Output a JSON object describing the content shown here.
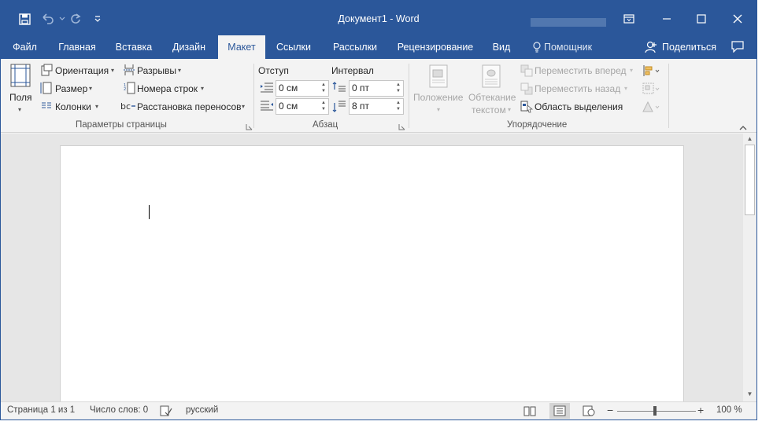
{
  "window": {
    "title": "Документ1  -  Word",
    "accent_color": "#2b579a"
  },
  "qat": {
    "save_icon": "save-icon",
    "undo_icon": "undo-icon",
    "redo_icon": "redo-icon",
    "customize_icon": "customize-qat-icon"
  },
  "tabs": [
    {
      "label": "Файл"
    },
    {
      "label": "Главная"
    },
    {
      "label": "Вставка"
    },
    {
      "label": "Дизайн"
    },
    {
      "label": "Макет"
    },
    {
      "label": "Ссылки"
    },
    {
      "label": "Рассылки"
    },
    {
      "label": "Рецензирование"
    },
    {
      "label": "Вид"
    },
    {
      "label": "Помощник"
    }
  ],
  "share": {
    "label": "Поделиться"
  },
  "ribbon": {
    "page_setup": {
      "margins_label": "Поля",
      "orientation_label": "Ориентация",
      "size_label": "Размер",
      "columns_label": "Колонки",
      "breaks_label": "Разрывы",
      "line_numbers_label": "Номера строк",
      "hyphenation_label": "Расстановка переносов",
      "group_label": "Параметры страницы"
    },
    "paragraph": {
      "indent_label": "Отступ",
      "spacing_label": "Интервал",
      "indent_left_value": "0 см",
      "indent_right_value": "0 см",
      "spacing_before_value": "0 пт",
      "spacing_after_value": "8 пт",
      "group_label": "Абзац"
    },
    "arrange": {
      "position_label": "Положение",
      "wrap_label_1": "Обтекание",
      "wrap_label_2": "текстом",
      "bring_forward_label": "Переместить вперед",
      "send_backward_label": "Переместить назад",
      "selection_pane_label": "Область выделения",
      "group_label": "Упорядочение"
    }
  },
  "status": {
    "page": "Страница 1 из 1",
    "words": "Число слов: 0",
    "language": "русский",
    "zoom": "100 %",
    "zoom_level_percent": 100
  }
}
